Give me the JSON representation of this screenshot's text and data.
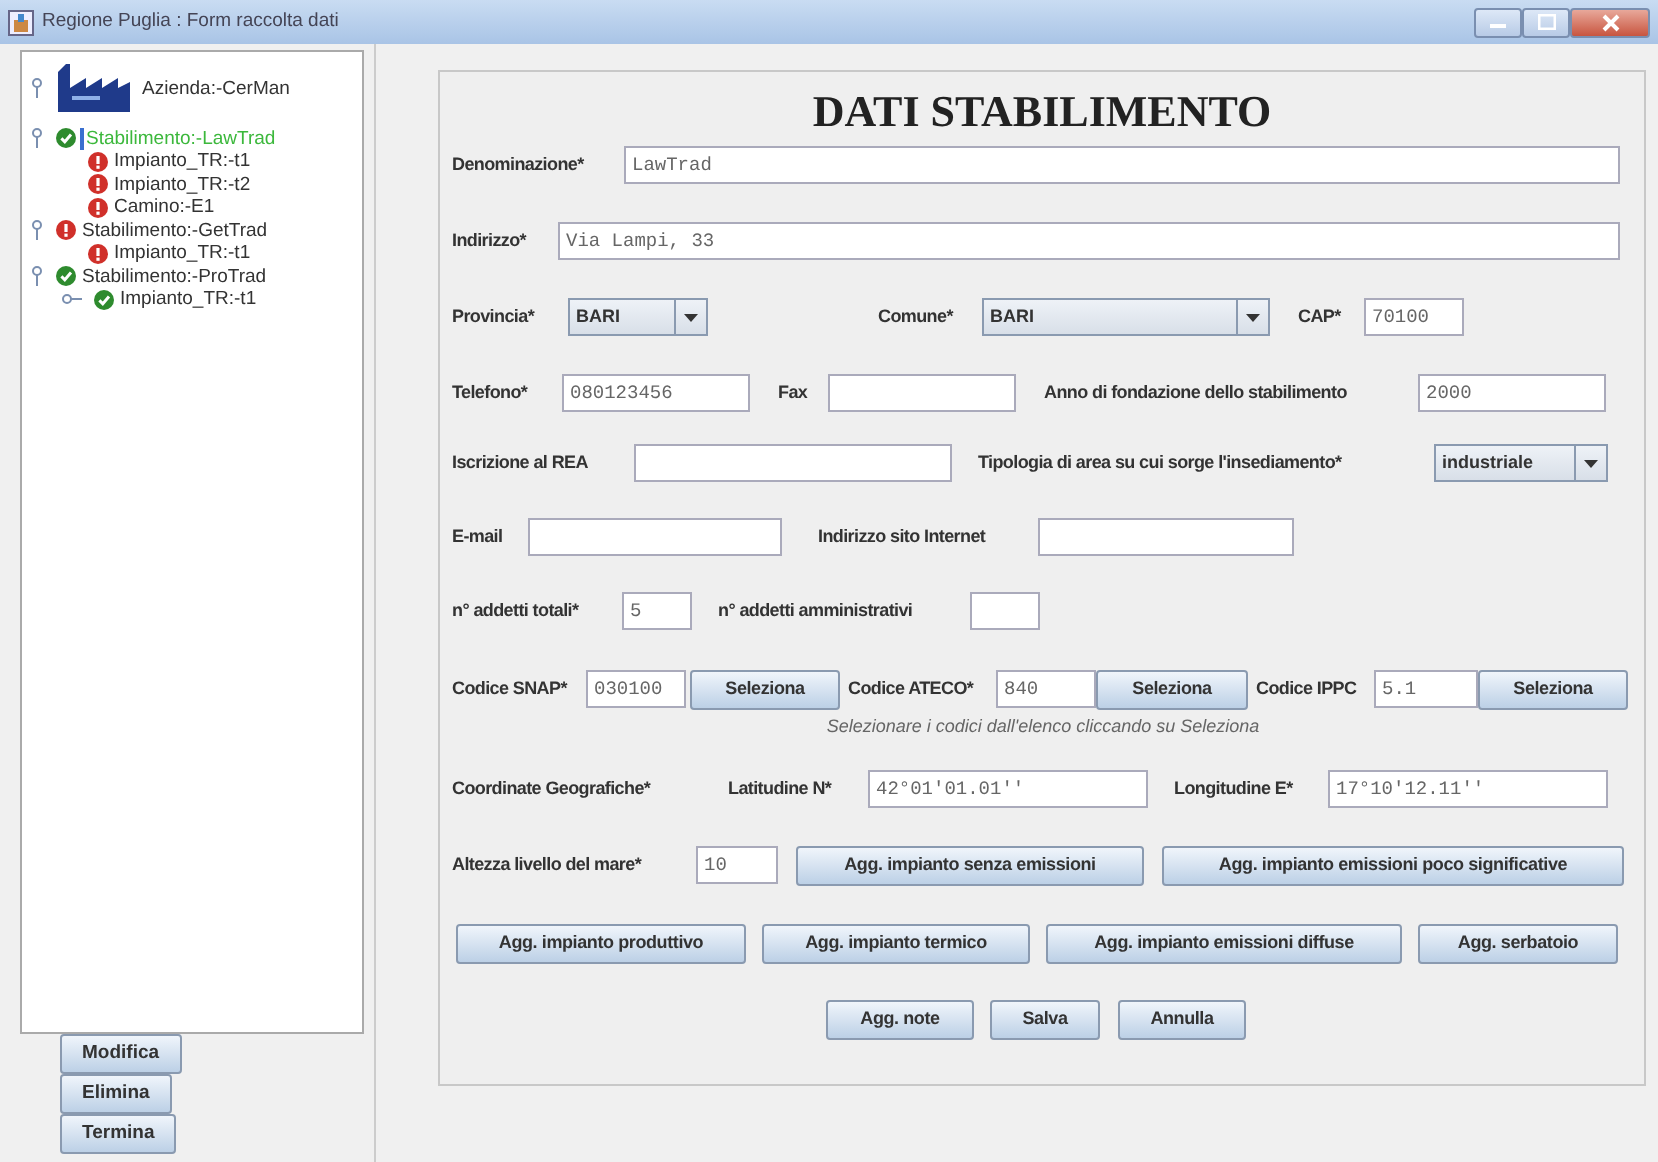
{
  "window": {
    "title": "Regione Puglia : Form raccolta dati"
  },
  "tree": {
    "label": "Azienda:-CerMan",
    "expanded": true,
    "children": [
      {
        "label": "Stabilimento:-LawTrad",
        "valid": true,
        "selected": true,
        "expanded": true,
        "children": [
          {
            "label": "Impianto_TR:-t1",
            "valid": false,
            "selected": false
          },
          {
            "label": "Impianto_TR:-t2",
            "valid": false,
            "selected": false
          },
          {
            "label": "Camino:-E1",
            "valid": false,
            "selected": false
          }
        ]
      },
      {
        "label": "Stabilimento:-GetTrad",
        "valid": false,
        "selected": false,
        "expanded": true,
        "children": [
          {
            "label": "Impianto_TR:-t1",
            "valid": false,
            "selected": false
          }
        ]
      },
      {
        "label": "Stabilimento:-ProTrad",
        "valid": true,
        "selected": false,
        "expanded": true,
        "children": [
          {
            "label": "Impianto_TR:-t1",
            "valid": true,
            "selected": false,
            "expanded": false
          }
        ]
      }
    ]
  },
  "side_buttons": [
    "Modifica",
    "Elimina",
    "Termina"
  ],
  "form": {
    "title": "DATI STABILIMENTO",
    "rows": [
      {
        "items": [
          {
            "kind": "label",
            "text": "Denominazione*"
          },
          {
            "kind": "field",
            "value": "LawTrad"
          }
        ]
      },
      {
        "items": [
          {
            "kind": "label",
            "text": "Indirizzo*"
          },
          {
            "kind": "field",
            "value": "Via Lampi, 33"
          }
        ]
      },
      {
        "items": [
          {
            "kind": "label",
            "text": "Provincia*"
          },
          {
            "kind": "combo",
            "value": "BARI"
          },
          {
            "kind": "label",
            "text": "Comune*"
          },
          {
            "kind": "combo",
            "value": "BARI"
          },
          {
            "kind": "label",
            "text": "CAP*"
          },
          {
            "kind": "field",
            "value": "70100"
          }
        ]
      },
      {
        "items": [
          {
            "kind": "label",
            "text": "Telefono*"
          },
          {
            "kind": "field",
            "value": "080123456"
          },
          {
            "kind": "label",
            "text": "Fax"
          },
          {
            "kind": "field",
            "value": ""
          },
          {
            "kind": "label",
            "text": "Anno di fondazione dello stabilimento"
          },
          {
            "kind": "field",
            "value": "2000"
          }
        ]
      },
      {
        "items": [
          {
            "kind": "label",
            "text": "Iscrizione al REA"
          },
          {
            "kind": "field",
            "value": ""
          },
          {
            "kind": "label",
            "text": "Tipologia di area su cui sorge l'insediamento*"
          },
          {
            "kind": "combo",
            "value": "industriale"
          }
        ]
      },
      {
        "items": [
          {
            "kind": "label",
            "text": "E-mail"
          },
          {
            "kind": "field",
            "value": ""
          },
          {
            "kind": "label",
            "text": "Indirizzo sito Internet"
          },
          {
            "kind": "field",
            "value": ""
          }
        ]
      },
      {
        "items": [
          {
            "kind": "label",
            "text": "n° addetti totali*"
          },
          {
            "kind": "field",
            "value": "5"
          },
          {
            "kind": "label",
            "text": "n° addetti amministrativi"
          },
          {
            "kind": "field",
            "value": ""
          }
        ]
      },
      {
        "items": [
          {
            "kind": "label",
            "text": "Codice SNAP*"
          },
          {
            "kind": "field",
            "value": "030100"
          },
          {
            "kind": "button",
            "text": "Seleziona"
          },
          {
            "kind": "label",
            "text": "Codice ATECO*"
          },
          {
            "kind": "field",
            "value": "840"
          },
          {
            "kind": "button",
            "text": "Seleziona"
          },
          {
            "kind": "label",
            "text": "Codice IPPC"
          },
          {
            "kind": "field",
            "value": "5.1"
          },
          {
            "kind": "button",
            "text": "Seleziona"
          }
        ]
      },
      {
        "items": [
          {
            "kind": "hint",
            "text": "Selezionare i codici dall'elenco cliccando su Seleziona"
          }
        ]
      },
      {
        "items": [
          {
            "kind": "label",
            "text": "Coordinate Geografiche*"
          },
          {
            "kind": "label",
            "text": "Latitudine N*"
          },
          {
            "kind": "field",
            "value": "42°01'01.01''"
          },
          {
            "kind": "label",
            "text": "Longitudine E*"
          },
          {
            "kind": "field",
            "value": "17°10'12.11''"
          }
        ]
      },
      {
        "items": [
          {
            "kind": "label",
            "text": "Altezza livello del mare*"
          },
          {
            "kind": "field",
            "value": "10"
          },
          {
            "kind": "button",
            "text": "Agg. impianto senza emissioni"
          },
          {
            "kind": "button",
            "text": "Agg. impianto emissioni poco significative"
          }
        ]
      },
      {
        "items": [
          {
            "kind": "button",
            "text": "Agg. impianto produttivo"
          },
          {
            "kind": "button",
            "text": "Agg. impianto termico"
          },
          {
            "kind": "button",
            "text": "Agg. impianto emissioni diffuse"
          },
          {
            "kind": "button",
            "text": "Agg. serbatoio"
          }
        ]
      },
      {
        "items": [
          {
            "kind": "button",
            "text": "Agg. note"
          },
          {
            "kind": "button",
            "text": "Salva"
          },
          {
            "kind": "button",
            "text": "Annulla"
          }
        ]
      }
    ]
  }
}
